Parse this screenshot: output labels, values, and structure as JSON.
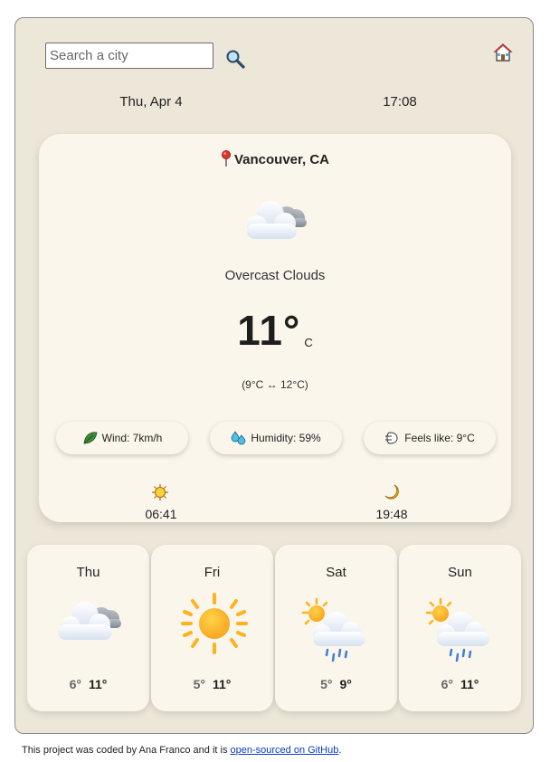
{
  "search": {
    "placeholder": "Search a city"
  },
  "icons": {
    "search": "magnifier-icon",
    "home": "house-icon"
  },
  "header": {
    "date": "Thu, Apr 4",
    "time": "17:08"
  },
  "current": {
    "location": "Vancouver, CA",
    "description": "Overcast Clouds",
    "temperature": "11°",
    "unit": "C",
    "minmax": "(9°C ↔ 12°C)",
    "wind": "Wind: 7km/h",
    "humidity": "Humidity: 59%",
    "feels_like": "Feels like: 9°C",
    "sunrise": "06:41",
    "sunset": "19:48"
  },
  "forecast": [
    {
      "day": "Thu",
      "min": "6°",
      "max": "11°",
      "icon": "overcast-clouds-icon"
    },
    {
      "day": "Fri",
      "min": "5°",
      "max": "11°",
      "icon": "sunny-icon"
    },
    {
      "day": "Sat",
      "min": "5°",
      "max": "9°",
      "icon": "sun-rain-icon"
    },
    {
      "day": "Sun",
      "min": "6°",
      "max": "11°",
      "icon": "sun-rain-icon"
    }
  ],
  "footer": {
    "prefix": "This project was coded by Ana Franco and it is ",
    "link": "open-sourced on GitHub",
    "suffix": "."
  },
  "colors": {
    "background": "#ece7d9",
    "card": "#faf6eb",
    "link": "#0a3dbf"
  }
}
